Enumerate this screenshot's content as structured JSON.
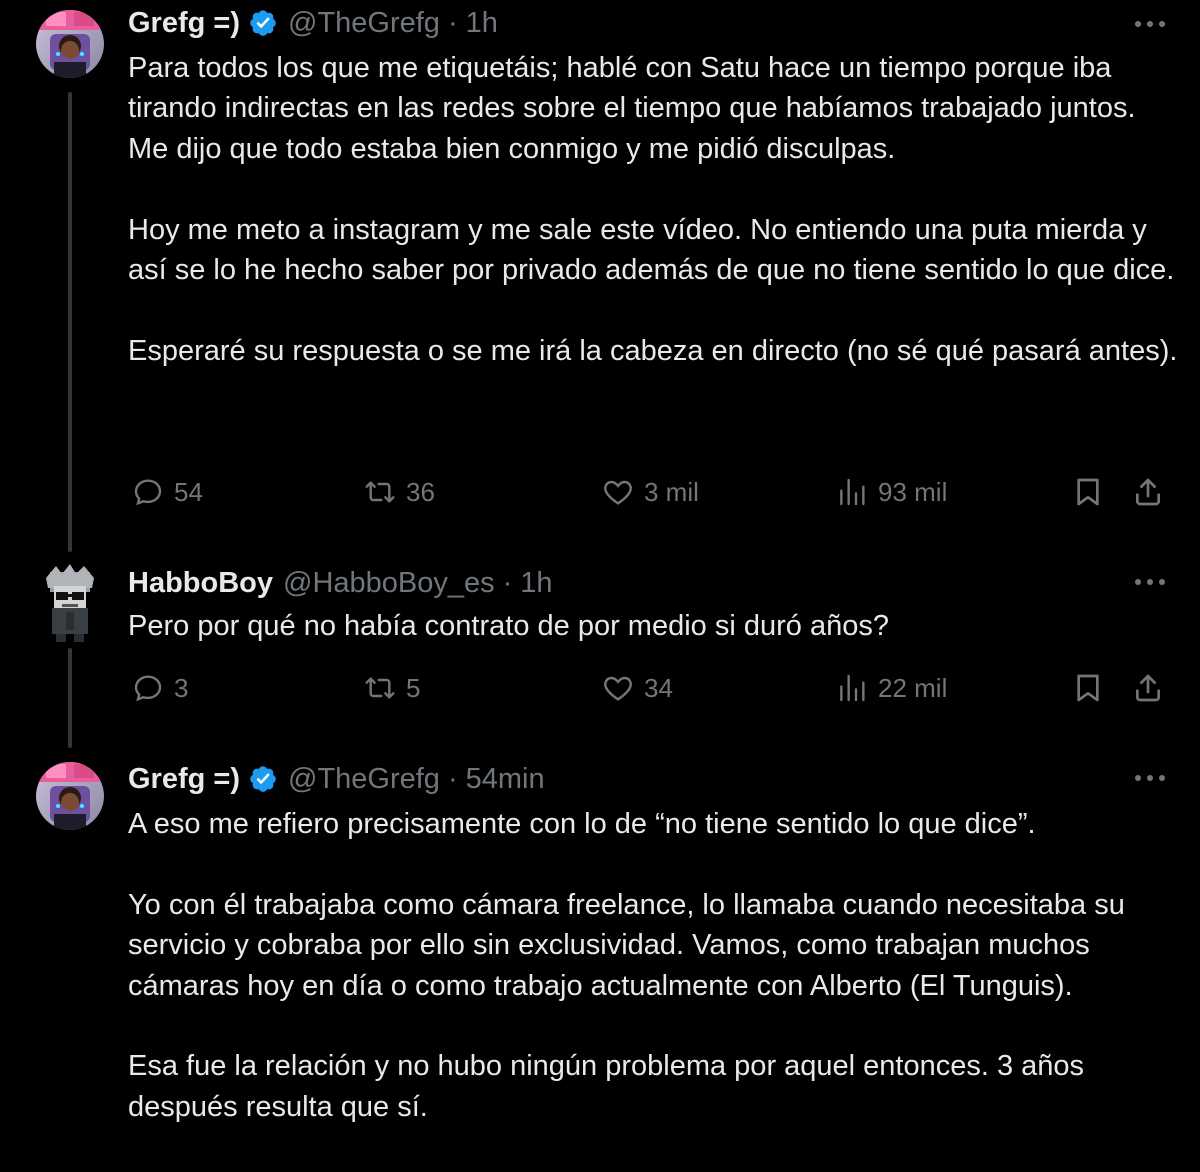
{
  "thread": [
    {
      "display_name": "Grefg =)",
      "verified": true,
      "handle": "@TheGrefg",
      "separator": "·",
      "time": "1h",
      "text": "Para todos los que me etiquetáis; hablé con Satu hace un tiempo porque iba tirando indirectas en las redes sobre el tiempo que habíamos trabajado juntos. Me dijo que todo estaba bien conmigo y me pidió disculpas.\n\nHoy me meto a instagram y me sale este vídeo. No entiendo una puta mierda y así se lo he hecho saber por privado además de que no tiene sentido lo que dice.\n\nEsperaré su respuesta o se me irá la cabeza en directo (no sé qué pasará antes).",
      "metrics": {
        "replies": "54",
        "reposts": "36",
        "likes": "3 mil",
        "views": "93 mil"
      }
    },
    {
      "display_name": "HabboBoy",
      "verified": false,
      "handle": "@HabboBoy_es",
      "separator": "·",
      "time": "1h",
      "text": "Pero por qué no había contrato de por medio si duró años?",
      "metrics": {
        "replies": "3",
        "reposts": "5",
        "likes": "34",
        "views": "22 mil"
      }
    },
    {
      "display_name": "Grefg =)",
      "verified": true,
      "handle": "@TheGrefg",
      "separator": "·",
      "time": "54min",
      "text": "A eso me refiero precisamente con lo de “no tiene sentido lo que dice”.\n\nYo con él trabajaba como cámara freelance, lo llamaba cuando necesitaba su servicio y cobraba por ello sin exclusividad. Vamos, como trabajan muchos cámaras hoy en día o como trabajo actualmente con Alberto (El Tunguis).\n\nEsa fue la relación y no hubo ningún problema por aquel entonces. 3 años después resulta que sí."
    }
  ],
  "colors": {
    "background": "#000000",
    "text": "#e7e9ea",
    "muted": "#71767b",
    "verified": "#1d9bf0",
    "thread_line": "#333639"
  },
  "icons": {
    "more": "more-horizontal-icon",
    "reply": "reply-bubble-icon",
    "repost": "repost-arrows-icon",
    "like": "heart-icon",
    "views": "views-bar-chart-icon",
    "bookmark": "bookmark-icon",
    "share": "share-upload-icon",
    "verified": "verified-badge-icon"
  }
}
